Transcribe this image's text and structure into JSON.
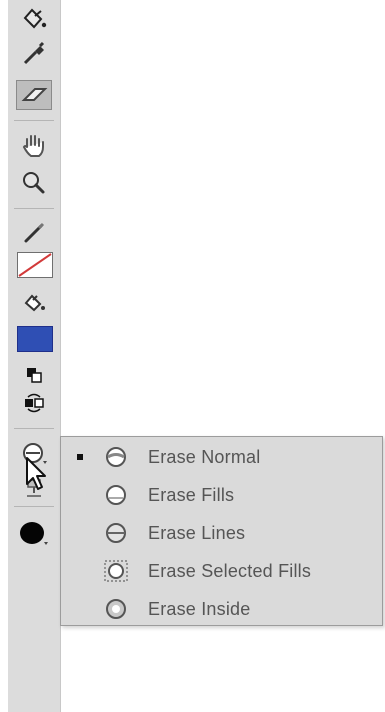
{
  "toolbar": {
    "tools": [
      {
        "name": "paint-bucket-tool",
        "icon": "paint-bucket-icon"
      },
      {
        "name": "eyedropper-tool",
        "icon": "eyedropper-icon"
      },
      {
        "name": "eraser-tool",
        "icon": "eraser-icon"
      },
      {
        "name": "hand-tool",
        "icon": "hand-icon"
      },
      {
        "name": "zoom-tool",
        "icon": "zoom-icon"
      },
      {
        "name": "stroke-color-tool",
        "icon": "pencil-icon"
      },
      {
        "name": "fill-color-tool",
        "icon": "paint-bucket-icon"
      },
      {
        "name": "default-colors-tool",
        "icon": "default-colors-icon"
      },
      {
        "name": "swap-colors-tool",
        "icon": "swap-colors-icon"
      },
      {
        "name": "eraser-mode-tool",
        "icon": "eraser-mode-icon"
      },
      {
        "name": "faucet-tool",
        "icon": "faucet-icon"
      },
      {
        "name": "eraser-shape-tool",
        "icon": "eraser-shape-icon"
      }
    ],
    "stroke_color": "#ffffff",
    "fill_color": "#2f4fb4",
    "selected_tool": "eraser-tool"
  },
  "menu": {
    "items": [
      {
        "label": "Erase Normal",
        "icon": "erase-normal-icon",
        "checked": true
      },
      {
        "label": "Erase Fills",
        "icon": "erase-fills-icon",
        "checked": false
      },
      {
        "label": "Erase Lines",
        "icon": "erase-lines-icon",
        "checked": false
      },
      {
        "label": "Erase Selected Fills",
        "icon": "erase-selected-fills-icon",
        "checked": false
      },
      {
        "label": "Erase Inside",
        "icon": "erase-inside-icon",
        "checked": false
      }
    ]
  }
}
